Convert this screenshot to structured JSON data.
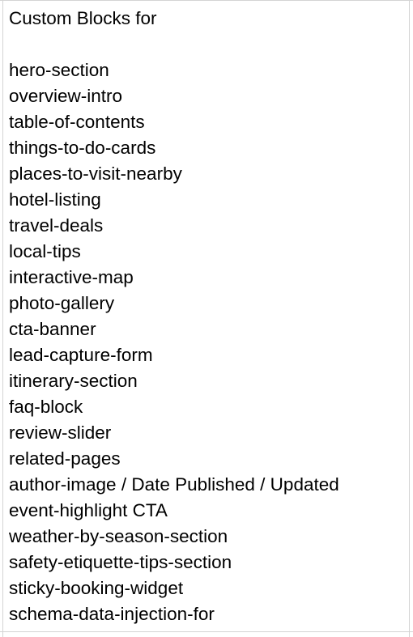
{
  "cell": {
    "title": "Custom Blocks for",
    "items": [
      "hero-section",
      "overview-intro",
      "table-of-contents",
      "things-to-do-cards",
      "places-to-visit-nearby",
      "hotel-listing",
      "travel-deals",
      "local-tips",
      "interactive-map",
      "photo-gallery",
      "cta-banner",
      "lead-capture-form",
      "itinerary-section",
      "faq-block",
      "review-slider",
      "related-pages",
      "author-image / Date Published / Updated",
      "event-highlight CTA",
      "weather-by-season-section",
      "safety-etiquette-tips-section",
      "sticky-booking-widget",
      "schema-data-injection-for"
    ]
  },
  "colors": {
    "gridline": "#d4d4d4",
    "text": "#000000",
    "background": "#ffffff"
  }
}
